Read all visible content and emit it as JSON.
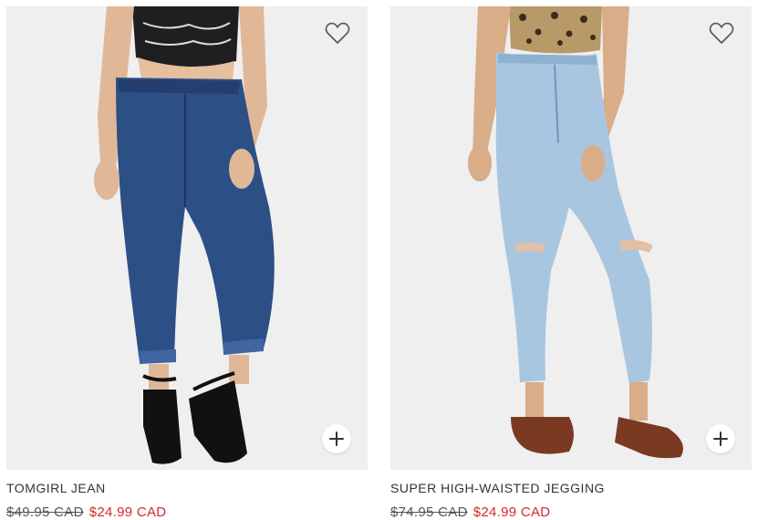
{
  "products": [
    {
      "name": "TOMGIRL JEAN",
      "original_price": "$49.95 CAD",
      "sale_price": "$24.99 CAD",
      "image_icon": "product-photo-dark-wash-jean",
      "favorite_icon": "heart-icon",
      "add_icon": "plus-icon"
    },
    {
      "name": "SUPER HIGH-WAISTED JEGGING",
      "original_price": "$74.95 CAD",
      "sale_price": "$24.99 CAD",
      "image_icon": "product-photo-light-wash-jegging",
      "favorite_icon": "heart-icon",
      "add_icon": "plus-icon"
    }
  ],
  "colors": {
    "sale_price": "#d6262c",
    "original_price": "#555555",
    "image_background": "#efefef"
  }
}
